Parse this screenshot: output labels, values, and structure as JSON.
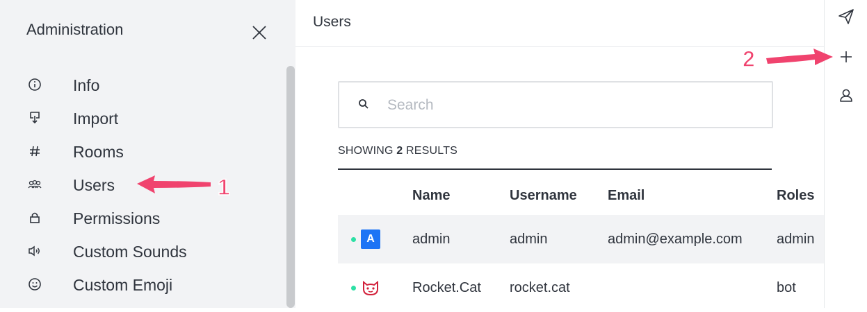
{
  "sidebar": {
    "title": "Administration",
    "items": [
      {
        "label": "Info",
        "icon": "info-icon"
      },
      {
        "label": "Import",
        "icon": "import-icon"
      },
      {
        "label": "Rooms",
        "icon": "hashtag-icon"
      },
      {
        "label": "Users",
        "icon": "team-icon"
      },
      {
        "label": "Permissions",
        "icon": "lock-icon"
      },
      {
        "label": "Custom Sounds",
        "icon": "volume-icon"
      },
      {
        "label": "Custom Emoji",
        "icon": "emoji-icon"
      }
    ]
  },
  "main": {
    "title": "Users",
    "search": {
      "placeholder": "Search",
      "value": ""
    },
    "showing": {
      "prefix": "SHOWING",
      "count": "2",
      "suffix": "RESULTS"
    },
    "table": {
      "headers": [
        "Name",
        "Username",
        "Email",
        "Roles"
      ],
      "rows": [
        {
          "status": "online",
          "avatar_text": "A",
          "name": "admin",
          "username": "admin",
          "email": "admin@example.com",
          "roles": "admin"
        },
        {
          "status": "online",
          "avatar_text": "",
          "name": "Rocket.Cat",
          "username": "rocket.cat",
          "email": "",
          "roles": "bot"
        }
      ]
    }
  },
  "rail": {
    "icons": [
      "send-icon",
      "plus-icon",
      "user-icon"
    ]
  },
  "annotations": {
    "step1": "1",
    "step2": "2",
    "arrow_color": "#f0436e"
  },
  "colors": {
    "accent": "#1d74f5",
    "online": "#2de0a5",
    "arrow": "#f0436e"
  }
}
